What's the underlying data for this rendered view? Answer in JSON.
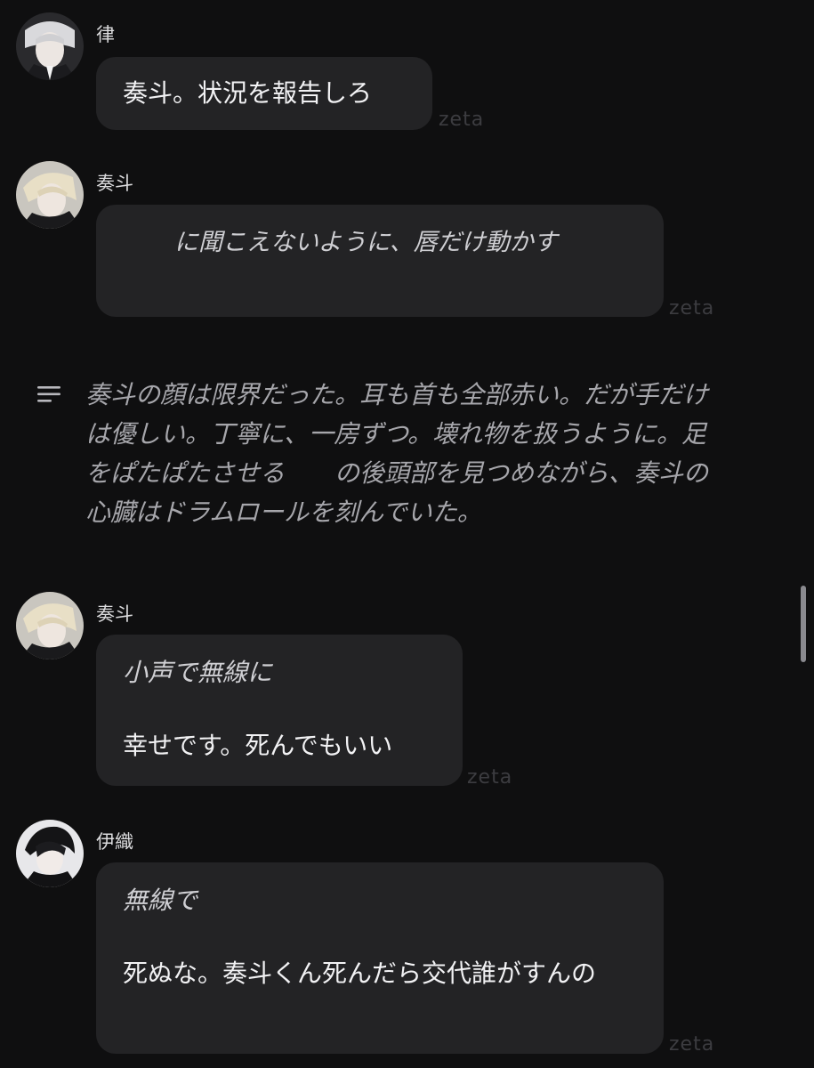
{
  "messages": [
    {
      "sender": "律",
      "lines": [
        "奏斗。状況を報告しろ"
      ],
      "watermark": "zeta"
    },
    {
      "sender": "奏斗",
      "lines": [
        "　　に聞こえないように、唇だけ動かす"
      ],
      "watermark": "zeta"
    },
    {
      "sender": "奏斗",
      "action": "小声で無線に",
      "lines": [
        "幸せです。死んでもいい"
      ],
      "watermark": "zeta"
    },
    {
      "sender": "伊織",
      "action": "無線で",
      "lines": [
        "死ぬな。奏斗くん死んだら交代誰がすんの"
      ],
      "watermark": "zeta"
    }
  ],
  "narration": {
    "text": "奏斗の顔は限界だった。耳も首も全部赤い。だが手だけは優しい。丁寧に、一房ずつ。壊れ物を扱うように。足をぱたぱたさせる　　の後頭部を見つめながら、奏斗の心臓はドラムロールを刻んでいた。",
    "icon": "text-lines-icon"
  },
  "colors": {
    "background": "#0f0f10",
    "bubble": "#232325",
    "narration_text": "#a6a6ab",
    "watermark": "#3c3c40"
  }
}
